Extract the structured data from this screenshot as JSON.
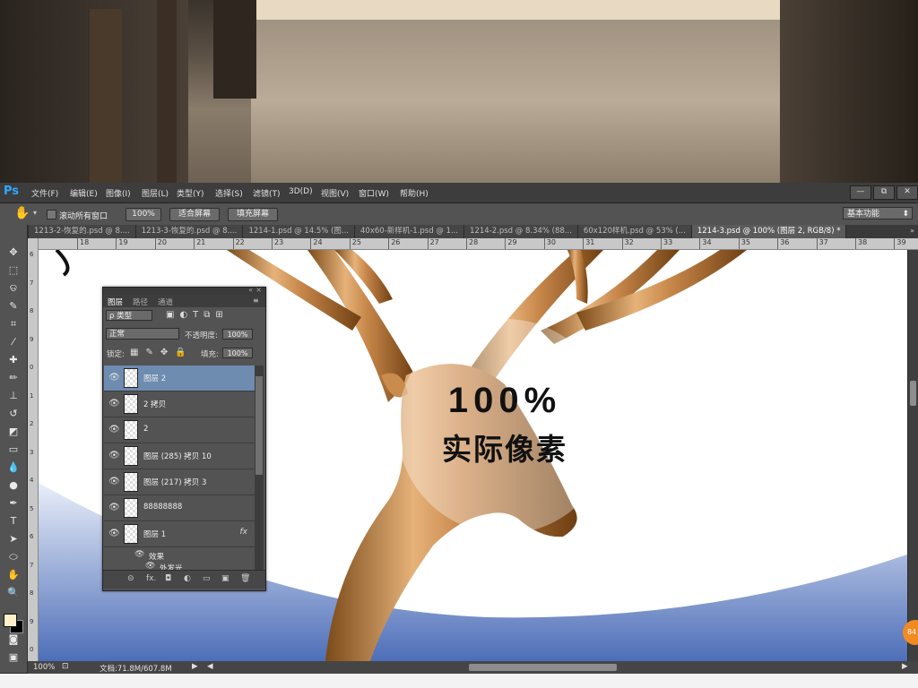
{
  "app": {
    "logo": "Ps",
    "accent": "#31a8ff"
  },
  "menu": [
    "文件(F)",
    "编辑(E)",
    "图像(I)",
    "图层(L)",
    "类型(Y)",
    "选择(S)",
    "滤镜(T)",
    "3D(D)",
    "视图(V)",
    "窗口(W)",
    "帮助(H)"
  ],
  "window_buttons": [
    "—",
    "⧉",
    "✕"
  ],
  "options": {
    "scroll_all_label": "滚动所有窗口",
    "zoom_value": "100%",
    "fit_screen": "适合屏幕",
    "fill_screen": "填充屏幕",
    "workspace": "基本功能"
  },
  "tabs": [
    "1213-2-恢复的.psd @ 8....",
    "1213-3-恢复的.psd @ 8....",
    "1214-1.psd @ 14.5% (图...",
    "40x60-新样机-1.psd @ 1...",
    "1214-2.psd @ 8.34% (88...",
    "60x120样机.psd @ 53% (...",
    "1214-3.psd @ 100% (图层 2, RGB/8) *"
  ],
  "active_tab_index": 6,
  "ruler_top_ticks": [
    "18",
    "19",
    "20",
    "21",
    "22",
    "23",
    "24",
    "25",
    "26",
    "27",
    "28",
    "29",
    "30",
    "31",
    "32",
    "33",
    "34",
    "35",
    "36",
    "37",
    "38",
    "39"
  ],
  "ruler_left_ticks": [
    "6",
    "7",
    "8",
    "9",
    "0",
    "1",
    "2",
    "3",
    "4",
    "5",
    "6",
    "7",
    "8",
    "9",
    "0"
  ],
  "canvas_overlay": {
    "big": "100%",
    "caption": "实际像素"
  },
  "layers_panel": {
    "tabs": [
      "图层",
      "路径",
      "通道"
    ],
    "filter_label": "ρ 类型",
    "blend_mode": "正常",
    "opacity_label": "不透明度:",
    "opacity": "100%",
    "lock_label": "锁定:",
    "fill_label": "填充:",
    "fill": "100%",
    "layers": [
      {
        "name": "图层 2",
        "selected": true,
        "fx": ""
      },
      {
        "name": "2 拷贝",
        "selected": false,
        "fx": ""
      },
      {
        "name": "2",
        "selected": false,
        "fx": ""
      },
      {
        "name": "图层 (285) 拷贝 10",
        "selected": false,
        "fx": ""
      },
      {
        "name": "图层 (217) 拷贝 3",
        "selected": false,
        "fx": ""
      },
      {
        "name": "88888888",
        "selected": false,
        "fx": ""
      },
      {
        "name": "图层 1",
        "selected": false,
        "fx": "fx"
      }
    ],
    "effects_label": "效果",
    "effect_item": "外发光",
    "bottom_icons": [
      "⊝",
      "fx.",
      "◘",
      "◐",
      "▭",
      "▣",
      "🗑"
    ]
  },
  "status": {
    "zoom": "100%",
    "doc": "文档:71.8M/607.8M"
  },
  "badge": "84"
}
